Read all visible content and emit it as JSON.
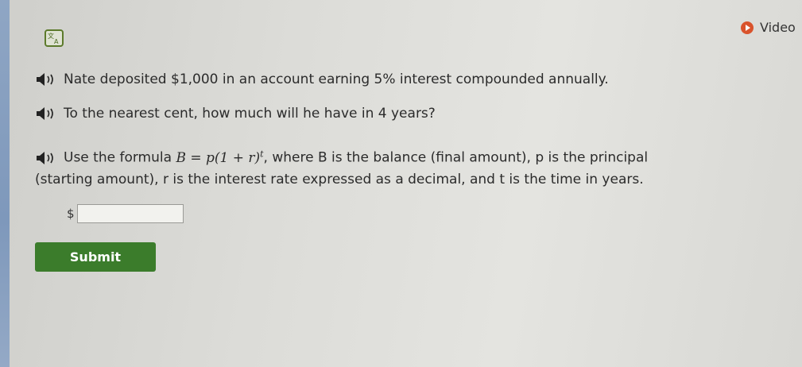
{
  "toolbar": {
    "translate_icon": "translate-icon",
    "video_label": "Video",
    "video_icon": "play-icon",
    "video_icon_color": "#d9532c"
  },
  "question": {
    "line1": "Nate deposited $1,000 in an account earning 5% interest compounded annually.",
    "line2": "To the nearest cent, how much will he have in 4 years?",
    "line3_prefix": "Use the formula",
    "formula_main": "B = p(1 + r)",
    "formula_exponent": "t",
    "line3_suffix": ", where B is the balance (final amount), p is the principal",
    "line4": "(starting amount), r is the interest rate expressed as a decimal, and t is the time in years."
  },
  "answer": {
    "currency_symbol": "$",
    "value": ""
  },
  "submit": {
    "label": "Submit",
    "color": "#3b7c2b"
  },
  "speaker_icon": "speaker-icon"
}
